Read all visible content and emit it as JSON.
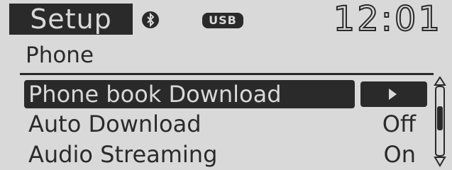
{
  "header": {
    "title": "Setup",
    "bluetooth_icon": "bluetooth-icon",
    "usb_label": "USB",
    "clock": "12:01"
  },
  "section": {
    "title": "Phone"
  },
  "menu": {
    "items": [
      {
        "label": "Phone book Download",
        "value": "",
        "selected": true
      },
      {
        "label": "Auto Download",
        "value": "Off",
        "selected": false
      },
      {
        "label": "Audio Streaming",
        "value": "On",
        "selected": false
      }
    ]
  },
  "colors": {
    "background": "#d9d9d9",
    "foreground": "#2a2a2a"
  }
}
